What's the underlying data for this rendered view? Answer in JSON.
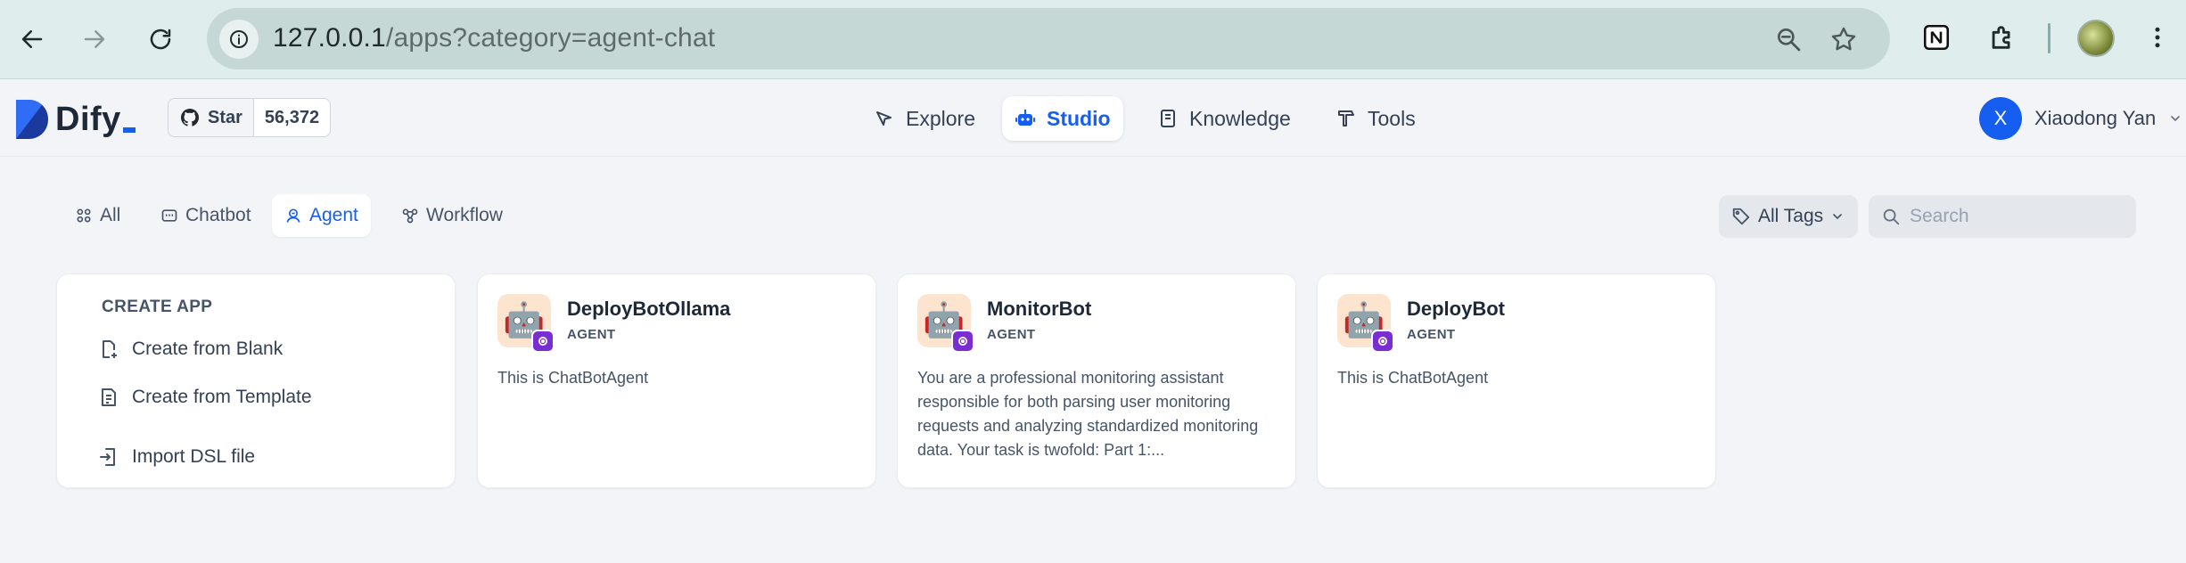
{
  "browser": {
    "url_host": "127.0.0.1",
    "url_path": "/apps?category=agent-chat"
  },
  "header": {
    "logo_text": "Dify",
    "github": {
      "label": "Star",
      "count": "56,372"
    },
    "nav": [
      {
        "label": "Explore",
        "icon": "compass-icon"
      },
      {
        "label": "Studio",
        "icon": "robot-icon",
        "active": true
      },
      {
        "label": "Knowledge",
        "icon": "book-icon"
      },
      {
        "label": "Tools",
        "icon": "hammer-icon"
      }
    ],
    "user": {
      "initial": "X",
      "name": "Xiaodong Yan"
    }
  },
  "filters": {
    "tabs": [
      {
        "label": "All",
        "icon": "grid-icon"
      },
      {
        "label": "Chatbot",
        "icon": "chat-icon"
      },
      {
        "label": "Agent",
        "icon": "agent-icon",
        "active": true
      },
      {
        "label": "Workflow",
        "icon": "workflow-icon"
      }
    ],
    "tags_label": "All Tags",
    "search_placeholder": "Search"
  },
  "create_app": {
    "title": "CREATE APP",
    "items": [
      "Create from Blank",
      "Create from Template",
      "Import DSL file"
    ]
  },
  "apps": [
    {
      "name": "DeployBotOllama",
      "mode": "AGENT",
      "description": "This is ChatBotAgent"
    },
    {
      "name": "MonitorBot",
      "mode": "AGENT",
      "description": "You are a professional monitoring assistant responsible for both parsing user monitoring requests and analyzing standardized monitoring data. Your task is twofold: Part 1:..."
    },
    {
      "name": "DeployBot",
      "mode": "AGENT",
      "description": "This is ChatBotAgent"
    }
  ],
  "colors": {
    "accent": "#155eef",
    "agent_badge": "#7a2ed1",
    "app_icon_bg": "#fde4cf"
  }
}
